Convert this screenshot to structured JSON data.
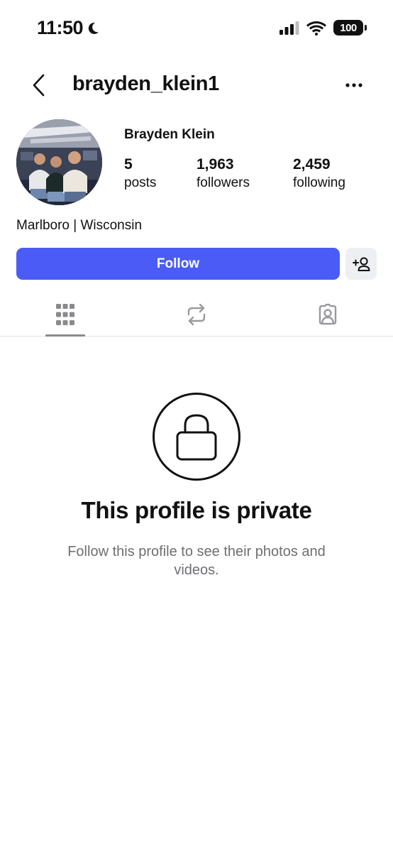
{
  "status_bar": {
    "time": "11:50",
    "battery": "100",
    "icons": [
      "moon-icon",
      "signal-icon",
      "wifi-icon",
      "battery-icon"
    ]
  },
  "header": {
    "username": "brayden_klein1",
    "back_icon": "chevron-left-icon",
    "more_icon": "more-horizontal-icon"
  },
  "profile": {
    "display_name": "Brayden Klein",
    "stats": [
      {
        "value": "5",
        "label": "posts"
      },
      {
        "value": "1,963",
        "label": "followers"
      },
      {
        "value": "2,459",
        "label": "following"
      }
    ],
    "bio": "Marlboro | Wisconsin"
  },
  "actions": {
    "follow_label": "Follow",
    "suggest_icon": "add-person-icon",
    "accent_color": "#4a5cf5"
  },
  "tabs": [
    {
      "icon": "grid-icon",
      "active": true
    },
    {
      "icon": "repost-icon",
      "active": false
    },
    {
      "icon": "tagged-icon",
      "active": false
    }
  ],
  "private": {
    "icon": "lock-icon",
    "title": "This profile is private",
    "subtitle": "Follow this profile to see their photos and videos."
  }
}
